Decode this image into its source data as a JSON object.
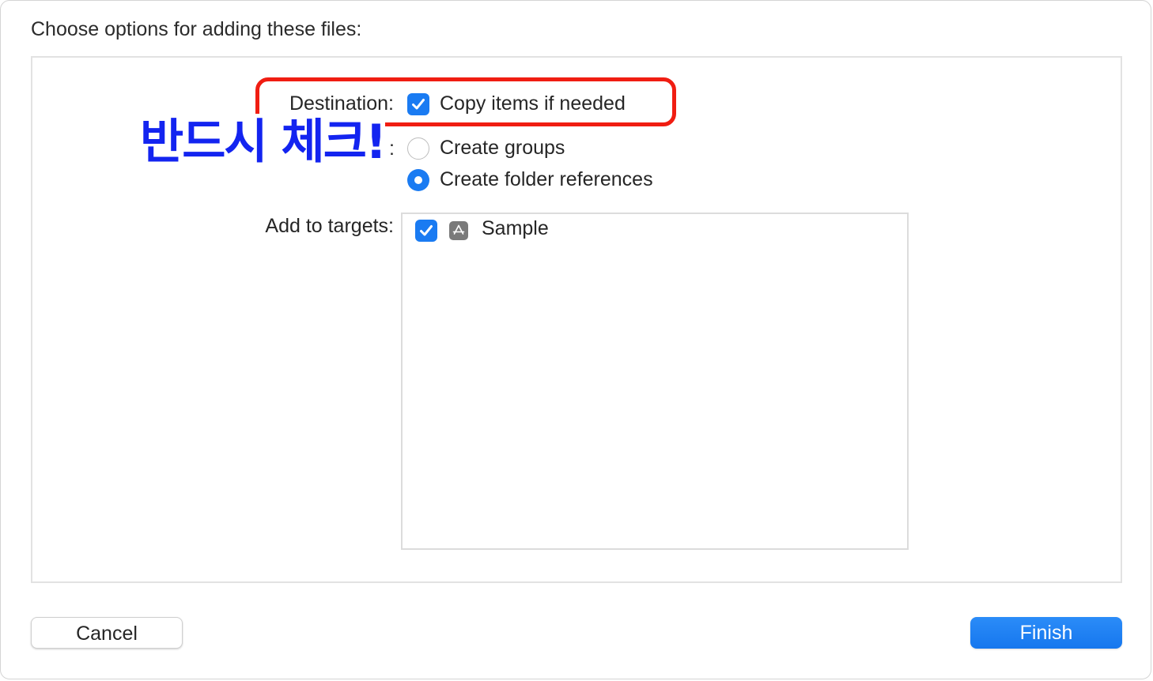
{
  "dialog": {
    "title": "Choose options for adding these files:"
  },
  "destination": {
    "label": "Destination:",
    "copy_items": {
      "label": "Copy items if needed",
      "checked": true
    }
  },
  "added_folders": {
    "label_visible_fragment": ":",
    "options": [
      {
        "label": "Create groups",
        "selected": false
      },
      {
        "label": "Create folder references",
        "selected": true
      }
    ]
  },
  "targets": {
    "label": "Add to targets:",
    "items": [
      {
        "label": "Sample",
        "checked": true,
        "icon": "app-target-icon"
      }
    ]
  },
  "annotation": {
    "text": "반드시 체크!",
    "color": "#1324f0",
    "highlight_color": "#f01d12"
  },
  "buttons": {
    "cancel": "Cancel",
    "finish": "Finish"
  },
  "colors": {
    "accent": "#1a7bf2"
  }
}
